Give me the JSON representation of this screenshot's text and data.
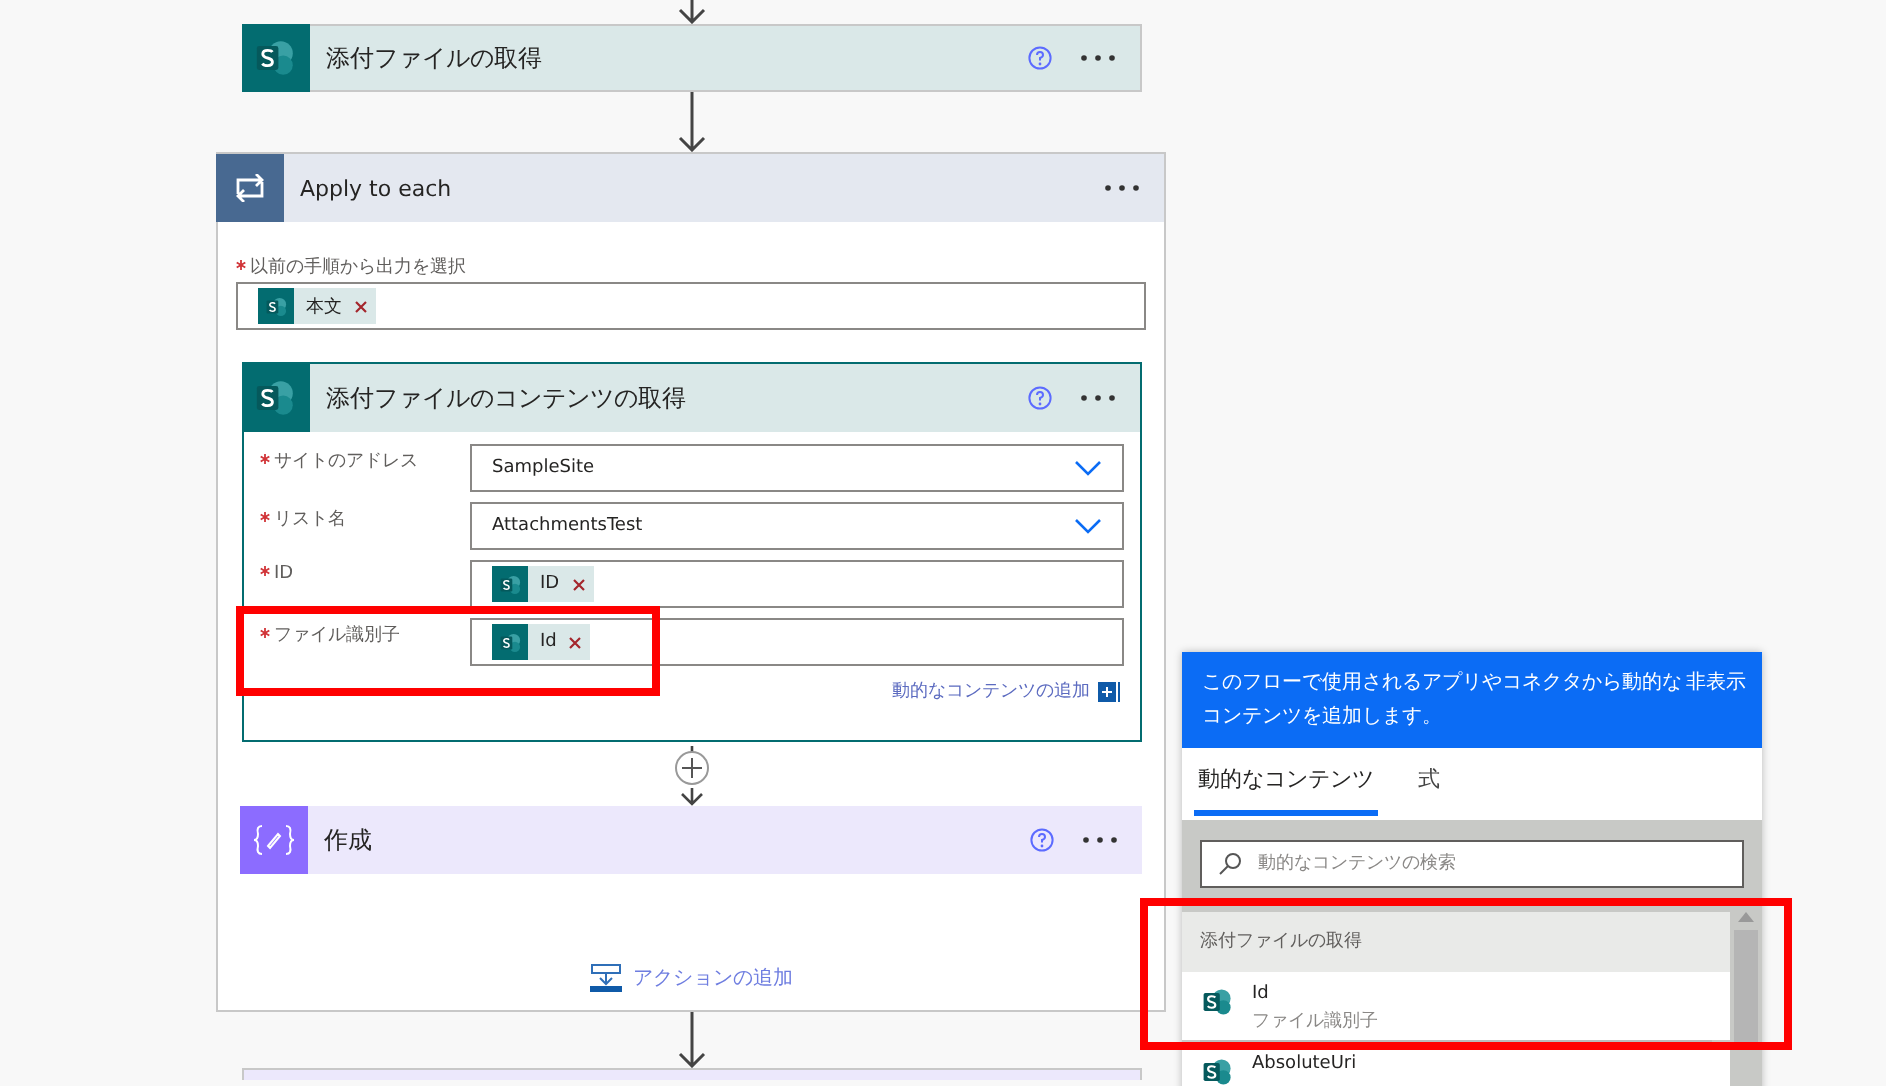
{
  "top_card": {
    "kind": "sharepoint",
    "title": "添付ファイルの取得"
  },
  "loop": {
    "title": "Apply to each",
    "field": {
      "label": "以前の手順から出力を選択",
      "required": true,
      "tokens": [
        "本文"
      ]
    },
    "actions": [
      {
        "kind": "sharepoint",
        "title": "添付ファイルのコンテンツの取得",
        "fields": [
          {
            "kind": "dropdown",
            "label": "サイトのアドレス",
            "required": true,
            "value": "SampleSite",
            "highlighted": false
          },
          {
            "kind": "dropdown",
            "label": "リスト名",
            "required": true,
            "value": "AttachmentsTest",
            "highlighted": false
          },
          {
            "kind": "tokens",
            "label": "ID",
            "required": true,
            "tokens": [
              "ID"
            ],
            "highlighted": false
          },
          {
            "kind": "tokens",
            "label": "ファイル識別子",
            "required": true,
            "tokens": [
              "Id"
            ],
            "highlighted": true
          }
        ],
        "link": "動的なコンテンツの追加"
      },
      {
        "kind": "compose",
        "title": "作成"
      }
    ],
    "add_action": "アクションの追加"
  },
  "popup": {
    "description": "このフローで使用されるアプリやコネクタから動的なコンテンツを追加します。",
    "hide_link": "非表示",
    "tabs": [
      {
        "label": "動的なコンテンツ",
        "selected": true
      },
      {
        "label": "式",
        "selected": false
      }
    ],
    "search": {
      "placeholder": "動的なコンテンツの検索"
    },
    "group": {
      "title": "添付ファイルの取得",
      "highlighted": true,
      "items": [
        {
          "name": "Id",
          "description": "ファイル識別子"
        },
        {
          "name": "AbsoluteUri"
        }
      ]
    }
  }
}
